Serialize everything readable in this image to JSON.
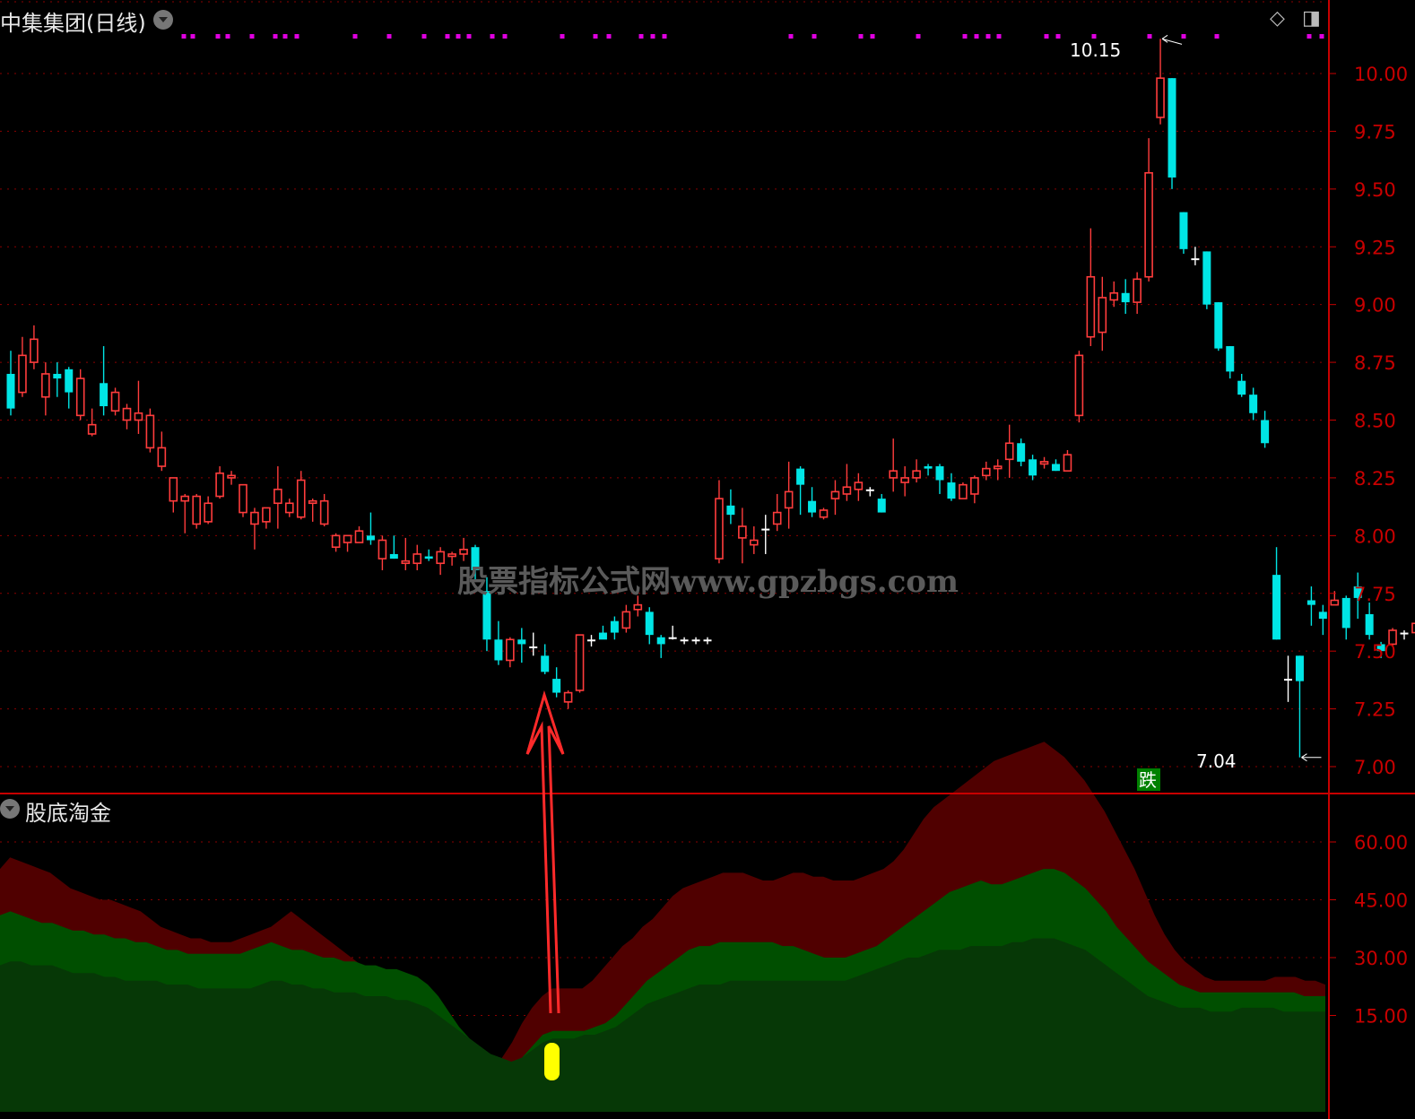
{
  "header": {
    "title": "中集集团(日线)",
    "indicator": "股底淘金",
    "watermark": "股票指标公式网www.gpzbgs.com",
    "high_label": "10.15",
    "low_label": "7.04",
    "badge": "跌"
  },
  "colors": {
    "up": "#ff3c3c",
    "down": "#00e5e5",
    "grid": "#8a0000",
    "axis": "#c80000",
    "magenta": "#e000e0"
  },
  "chart_data": [
    {
      "type": "candlestick",
      "y_ticks": [
        "10.00",
        "9.75",
        "9.50",
        "9.25",
        "9.00",
        "8.75",
        "8.50",
        "8.25",
        "8.00",
        "7.75",
        "7.50",
        "7.25",
        "7.00"
      ],
      "ylim": [
        7.0,
        10.0
      ],
      "candles": [
        [
          8.7,
          8.55,
          8.8,
          8.52
        ],
        [
          8.62,
          8.78,
          8.86,
          8.6
        ],
        [
          8.75,
          8.85,
          8.91,
          8.72
        ],
        [
          8.6,
          8.7,
          8.75,
          8.52
        ],
        [
          8.7,
          8.68,
          8.75,
          8.6
        ],
        [
          8.72,
          8.62,
          8.73,
          8.55
        ],
        [
          8.52,
          8.68,
          8.72,
          8.5
        ],
        [
          8.44,
          8.48,
          8.55,
          8.43
        ],
        [
          8.66,
          8.56,
          8.82,
          8.52
        ],
        [
          8.54,
          8.62,
          8.64,
          8.52
        ],
        [
          8.5,
          8.55,
          8.57,
          8.46
        ],
        [
          8.5,
          8.53,
          8.67,
          8.44
        ],
        [
          8.38,
          8.52,
          8.55,
          8.36
        ],
        [
          8.3,
          8.38,
          8.45,
          8.28
        ],
        [
          8.15,
          8.25,
          8.25,
          8.1
        ],
        [
          8.15,
          8.17,
          8.18,
          8.01
        ],
        [
          8.05,
          8.17,
          8.18,
          8.03
        ],
        [
          8.06,
          8.14,
          8.17,
          8.05
        ],
        [
          8.17,
          8.27,
          8.3,
          8.16
        ],
        [
          8.25,
          8.26,
          8.28,
          8.22
        ],
        [
          8.1,
          8.22,
          8.22,
          8.08
        ],
        [
          8.05,
          8.1,
          8.12,
          7.94
        ],
        [
          8.06,
          8.12,
          8.12,
          8.03
        ],
        [
          8.14,
          8.2,
          8.3,
          8.03
        ],
        [
          8.1,
          8.14,
          8.16,
          8.08
        ],
        [
          8.08,
          8.24,
          8.28,
          8.07
        ],
        [
          8.14,
          8.15,
          8.16,
          8.06
        ],
        [
          8.05,
          8.15,
          8.18,
          8.04
        ],
        [
          7.95,
          8.0,
          8.01,
          7.93
        ],
        [
          7.97,
          8.0,
          8.0,
          7.93
        ],
        [
          7.97,
          8.02,
          8.04,
          7.97
        ],
        [
          8.0,
          7.98,
          8.1,
          7.96
        ],
        [
          7.9,
          7.98,
          8.0,
          7.85
        ],
        [
          7.92,
          7.9,
          8.0,
          7.9
        ],
        [
          7.88,
          7.89,
          7.99,
          7.85
        ],
        [
          7.88,
          7.92,
          7.96,
          7.85
        ],
        [
          7.91,
          7.9,
          7.94,
          7.89
        ],
        [
          7.88,
          7.93,
          7.95,
          7.83
        ],
        [
          7.91,
          7.92,
          7.93,
          7.87
        ],
        [
          7.92,
          7.94,
          7.99,
          7.89
        ],
        [
          7.95,
          7.85,
          7.96,
          7.81
        ],
        [
          7.76,
          7.55,
          7.82,
          7.5
        ],
        [
          7.55,
          7.46,
          7.63,
          7.44
        ],
        [
          7.46,
          7.55,
          7.56,
          7.43
        ],
        [
          7.55,
          7.53,
          7.6,
          7.45
        ],
        [
          7.52,
          7.52,
          7.58,
          7.48
        ],
        [
          7.48,
          7.41,
          7.53,
          7.4
        ],
        [
          7.38,
          7.32,
          7.43,
          7.3
        ],
        [
          7.28,
          7.32,
          7.33,
          7.25
        ],
        [
          7.33,
          7.57,
          7.57,
          7.32
        ],
        [
          7.55,
          7.55,
          7.57,
          7.52
        ],
        [
          7.58,
          7.55,
          7.61,
          7.56
        ],
        [
          7.63,
          7.58,
          7.65,
          7.55
        ],
        [
          7.6,
          7.67,
          7.7,
          7.58
        ],
        [
          7.68,
          7.7,
          7.74,
          7.65
        ],
        [
          7.67,
          7.57,
          7.69,
          7.53
        ],
        [
          7.56,
          7.53,
          7.57,
          7.47
        ],
        [
          7.56,
          7.56,
          7.61,
          7.55
        ],
        [
          7.55,
          7.55,
          7.56,
          7.53
        ],
        [
          7.55,
          7.55,
          7.56,
          7.53
        ],
        [
          7.55,
          7.55,
          7.56,
          7.53
        ],
        [
          7.9,
          8.16,
          8.24,
          7.88
        ],
        [
          8.13,
          8.09,
          8.2,
          8.05
        ],
        [
          7.99,
          8.04,
          8.12,
          7.88
        ],
        [
          7.96,
          7.98,
          8.04,
          7.92
        ],
        [
          8.03,
          8.03,
          8.09,
          7.92
        ],
        [
          8.05,
          8.1,
          8.18,
          8.02
        ],
        [
          8.12,
          8.19,
          8.32,
          8.03
        ],
        [
          8.29,
          8.22,
          8.3,
          8.09
        ],
        [
          8.15,
          8.1,
          8.21,
          8.08
        ],
        [
          8.08,
          8.11,
          8.12,
          8.07
        ],
        [
          8.16,
          8.19,
          8.24,
          8.09
        ],
        [
          8.18,
          8.21,
          8.31,
          8.15
        ],
        [
          8.2,
          8.23,
          8.27,
          8.15
        ],
        [
          8.2,
          8.2,
          8.21,
          8.17
        ],
        [
          8.16,
          8.1,
          8.18,
          8.1
        ],
        [
          8.25,
          8.28,
          8.42,
          8.19
        ],
        [
          8.23,
          8.25,
          8.3,
          8.17
        ],
        [
          8.25,
          8.28,
          8.33,
          8.23
        ],
        [
          8.3,
          8.29,
          8.31,
          8.26
        ],
        [
          8.3,
          8.24,
          8.31,
          8.18
        ],
        [
          8.23,
          8.16,
          8.27,
          8.15
        ],
        [
          8.16,
          8.22,
          8.23,
          8.19
        ],
        [
          8.18,
          8.25,
          8.26,
          8.14
        ],
        [
          8.26,
          8.29,
          8.32,
          8.24
        ],
        [
          8.29,
          8.3,
          8.33,
          8.24
        ],
        [
          8.33,
          8.4,
          8.48,
          8.25
        ],
        [
          8.4,
          8.32,
          8.42,
          8.3
        ],
        [
          8.33,
          8.26,
          8.35,
          8.24
        ],
        [
          8.31,
          8.32,
          8.34,
          8.29
        ],
        [
          8.31,
          8.28,
          8.33,
          8.28
        ],
        [
          8.28,
          8.35,
          8.37,
          8.28
        ],
        [
          8.52,
          8.78,
          8.8,
          8.49
        ],
        [
          8.86,
          9.12,
          9.33,
          8.82
        ],
        [
          8.88,
          9.03,
          9.12,
          8.8
        ],
        [
          9.02,
          9.05,
          9.1,
          8.99
        ],
        [
          9.05,
          9.01,
          9.11,
          8.96
        ],
        [
          9.01,
          9.11,
          9.14,
          8.96
        ],
        [
          9.12,
          9.57,
          9.72,
          9.1
        ],
        [
          9.81,
          9.98,
          10.15,
          9.78
        ],
        [
          9.98,
          9.55,
          9.98,
          9.5
        ],
        [
          9.4,
          9.24,
          9.4,
          9.22
        ],
        [
          9.2,
          9.2,
          9.25,
          9.17
        ],
        [
          9.23,
          9.0,
          9.23,
          8.98
        ],
        [
          9.01,
          8.81,
          9.01,
          8.8
        ],
        [
          8.82,
          8.71,
          8.82,
          8.68
        ],
        [
          8.67,
          8.61,
          8.7,
          8.6
        ],
        [
          8.61,
          8.53,
          8.64,
          8.5
        ],
        [
          8.5,
          8.4,
          8.54,
          8.38
        ],
        [
          7.83,
          7.55,
          7.95,
          7.55
        ],
        [
          7.38,
          7.38,
          7.48,
          7.28
        ],
        [
          7.48,
          7.37,
          7.48,
          7.04
        ],
        [
          7.72,
          7.7,
          7.78,
          7.61
        ],
        [
          7.67,
          7.64,
          7.7,
          7.57
        ],
        [
          7.7,
          7.72,
          7.76,
          7.7
        ],
        [
          7.73,
          7.6,
          7.74,
          7.55
        ],
        [
          7.78,
          7.73,
          7.84,
          7.64
        ],
        [
          7.66,
          7.57,
          7.71,
          7.55
        ],
        [
          7.53,
          7.5,
          7.54,
          7.47
        ],
        [
          7.53,
          7.59,
          7.6,
          7.52
        ],
        [
          7.58,
          7.58,
          7.59,
          7.55
        ],
        [
          7.58,
          7.62,
          7.63,
          7.57
        ],
        [
          7.69,
          7.65,
          7.73,
          7.6
        ],
        [
          7.64,
          7.62,
          7.66,
          7.58
        ],
        [
          7.62,
          7.63,
          7.64,
          7.58
        ]
      ]
    },
    {
      "type": "area",
      "y_ticks": [
        "60.00",
        "45.00",
        "30.00",
        "15.00"
      ],
      "ylim": [
        0,
        60
      ],
      "series": [
        {
          "values": [
            53,
            56,
            55,
            54,
            53,
            52,
            50,
            48,
            47,
            46,
            45,
            45,
            44,
            43,
            42,
            40,
            38,
            37,
            36,
            35,
            35,
            34,
            34,
            34,
            35,
            36,
            37,
            38,
            40,
            42,
            40,
            38,
            36,
            34,
            32,
            30,
            28,
            26,
            25,
            24,
            23,
            22,
            20,
            16,
            12,
            9,
            7,
            5,
            4,
            3,
            4,
            8,
            13,
            17,
            20,
            22,
            22,
            22,
            22,
            24,
            27,
            30,
            33,
            35,
            38,
            40,
            43,
            46,
            48,
            49,
            50,
            51,
            52,
            52,
            52,
            51,
            50,
            50,
            51,
            52,
            52,
            51,
            51,
            50,
            50,
            50,
            51,
            52,
            53,
            55,
            58,
            62,
            66,
            69,
            71,
            73,
            75,
            77,
            79,
            81,
            82,
            83,
            84,
            85,
            86,
            84,
            82,
            79,
            76,
            72,
            68,
            63,
            58,
            53,
            47,
            41,
            36,
            32,
            29,
            27,
            25,
            24,
            24,
            24,
            24,
            24,
            24,
            25,
            25,
            25,
            24,
            24,
            23
          ]
        },
        {
          "values": [
            41,
            42,
            41,
            40,
            39,
            39,
            38,
            37,
            37,
            36,
            36,
            35,
            35,
            34,
            34,
            33,
            32,
            32,
            31,
            31,
            31,
            31,
            31,
            31,
            32,
            33,
            34,
            33,
            32,
            32,
            31,
            30,
            30,
            29,
            29,
            28,
            28,
            27,
            27,
            26,
            25,
            23,
            20,
            16,
            12,
            9,
            7,
            5,
            4,
            3,
            4,
            7,
            10,
            11,
            11,
            11,
            11,
            12,
            13,
            15,
            18,
            21,
            24,
            26,
            28,
            30,
            32,
            33,
            33,
            34,
            34,
            34,
            34,
            34,
            34,
            33,
            33,
            32,
            31,
            30,
            30,
            30,
            31,
            32,
            33,
            35,
            37,
            39,
            41,
            43,
            45,
            47,
            48,
            49,
            50,
            49,
            49,
            50,
            51,
            52,
            53,
            53,
            52,
            50,
            48,
            45,
            42,
            38,
            35,
            32,
            29,
            27,
            25,
            23,
            22,
            21,
            21,
            21,
            21,
            21,
            21,
            21,
            21,
            21,
            21,
            20,
            20,
            20
          ]
        },
        {
          "values": [
            28,
            29,
            29,
            28,
            28,
            28,
            27,
            26,
            26,
            26,
            25,
            25,
            24,
            24,
            24,
            24,
            23,
            23,
            23,
            22,
            22,
            22,
            22,
            22,
            22,
            23,
            24,
            24,
            23,
            23,
            22,
            22,
            21,
            21,
            21,
            20,
            20,
            20,
            19,
            19,
            18,
            17,
            15,
            13,
            11,
            9,
            7,
            5,
            4,
            3,
            4,
            6,
            8,
            9,
            9,
            9,
            10,
            10,
            11,
            12,
            14,
            16,
            18,
            19,
            20,
            21,
            22,
            23,
            23,
            23,
            24,
            24,
            24,
            24,
            24,
            24,
            24,
            24,
            24,
            24,
            24,
            24,
            25,
            26,
            27,
            28,
            29,
            30,
            30,
            31,
            32,
            32,
            32,
            33,
            33,
            33,
            33,
            34,
            34,
            35,
            35,
            35,
            34,
            33,
            32,
            30,
            28,
            26,
            24,
            22,
            20,
            19,
            18,
            17,
            17,
            17,
            16,
            16,
            16,
            17,
            17,
            17,
            17,
            16,
            16,
            16,
            16,
            16
          ]
        }
      ]
    }
  ]
}
